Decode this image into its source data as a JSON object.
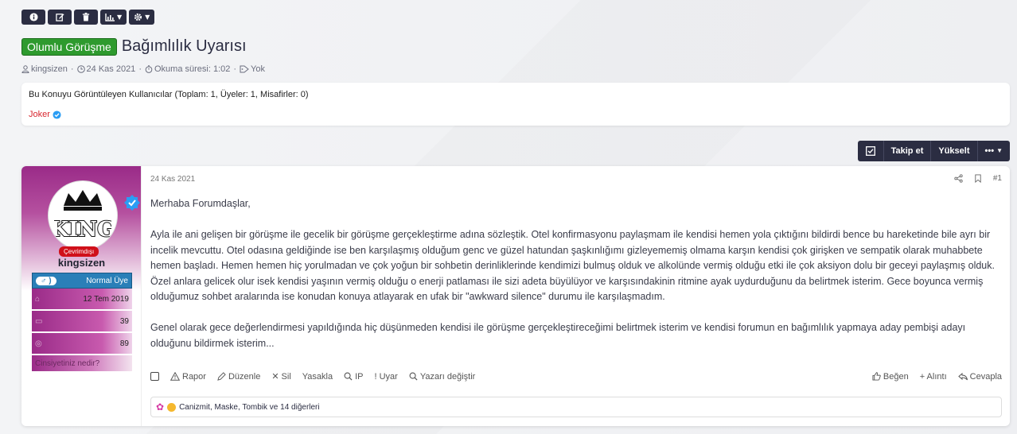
{
  "toolbar": {
    "info_icon": "info-icon",
    "edit_icon": "edit-icon",
    "delete_icon": "trash-icon",
    "chart_icon": "chart-icon",
    "settings_icon": "gear-icon"
  },
  "thread": {
    "prefix": "Olumlu Görüşme",
    "title": "Bağımlılık Uyarısı",
    "author": "kingsizen",
    "date": "24 Kas 2021",
    "read_time": "Okuma süresi: 1:02",
    "tags": "Yok"
  },
  "viewers": {
    "summary": "Bu Konuyu Görüntüleyen Kullanıcılar (Toplam: 1, Üyeler: 1, Misafirler: 0)",
    "user": "Joker"
  },
  "action_bar": {
    "follow": "Takip et",
    "bump": "Yükselt",
    "more": "•••"
  },
  "post": {
    "date": "24 Kas 2021",
    "number": "#1",
    "paragraphs": [
      "Merhaba Forumdaşlar,",
      "Ayla ile ani gelişen bir görüşme ile gecelik bir görüşme gerçekleştirme adına sözleştik. Otel konfirmasyonu paylaşmam ile kendisi hemen yola çıktığını bildirdi bence bu hareketinde bile ayrı bir incelik mevcuttu. Otel odasına geldiğinde ise ben karşılaşmış olduğum genc ve güzel hatundan şaşkınlığımı gizleyememiş olmama karşın kendisi çok girişken ve sempatik olarak muhabbete hemen başladı. Hemen hemen hiç yorulmadan ve çok yoğun bir sohbetin derinliklerinde kendimizi bulmuş olduk ve alkolünde vermiş olduğu etki ile çok aksiyon dolu bir geceyi paylaşmış olduk. Özel anlara gelicek olur isek kendisi yaşının vermiş olduğu o enerji patlaması ile sizi adeta büyülüyor ve karşısındakinin ritmine ayak uydurduğunu da belirtmek isterim. Gece boyunca vermiş olduğumuz sohbet aralarında ise konudan konuya atlayarak en ufak bir \"awkward silence\" durumu ile karşılaşmadım.",
      "Genel olarak gece değerlendirmesi yapıldığında hiç düşünmeden kendisi ile görüşme gerçekleştireceğimi belirtmek isterim ve kendisi forumun en bağımlılık yapmaya aday pembişi adayı olduğunu bildirmek isterim..."
    ],
    "actions": {
      "report": "Rapor",
      "edit": "Düzenle",
      "delete": "Sil",
      "ban": "Yasakla",
      "ip": "IP",
      "warn": "Uyar",
      "change_author": "Yazarı değiştir",
      "like": "Beğen",
      "quote": "+ Alıntı",
      "reply": "Cevapla"
    },
    "reactions_text": "Canizmit, Maske, Tombik ve 14 diğerleri"
  },
  "user": {
    "name": "kingsizen",
    "status": "Çevrimdışı",
    "avatar_text": "KING",
    "gender_symbol": "♂ )",
    "role": "Normal Üye",
    "joined": "12 Tem 2019",
    "messages": "39",
    "points": "89",
    "gender_question": "Cinsiyetiniz nedir?"
  }
}
